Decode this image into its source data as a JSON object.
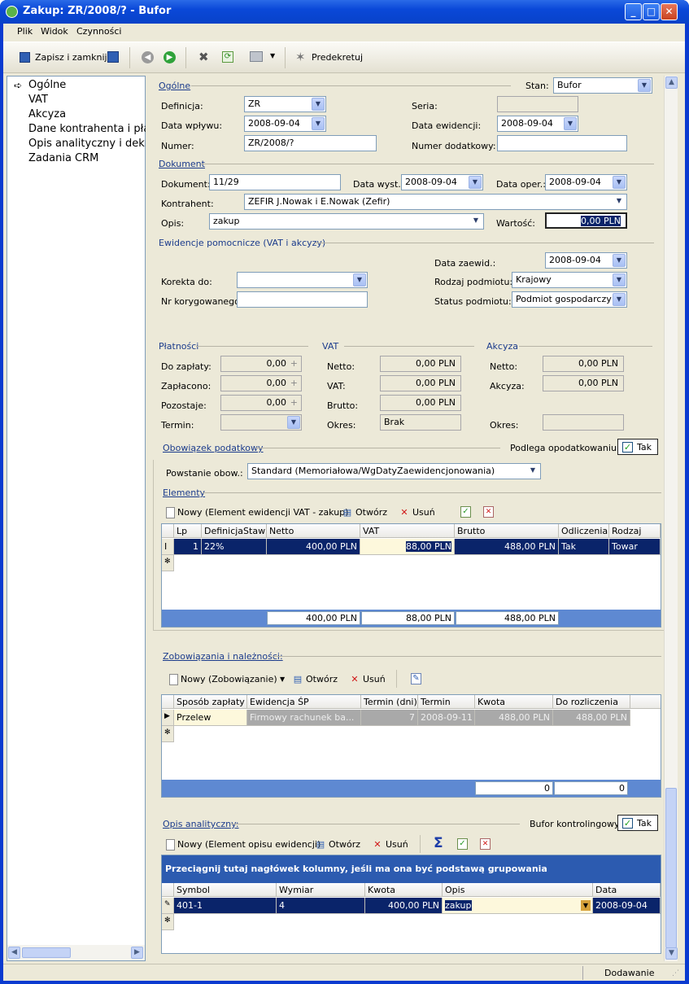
{
  "window": {
    "title": "Zakup: ZR/2008/? - Bufor"
  },
  "menu": [
    "Plik",
    "Widok",
    "Czynności"
  ],
  "toolbar": {
    "save_close": "Zapisz i zamknij",
    "predekretuj": "Predekretuj"
  },
  "nav": {
    "items": [
      "Ogólne",
      "VAT",
      "Akcyza",
      "Dane kontrahenta i płatn",
      "Opis analityczny i dekret",
      "Zadania CRM"
    ]
  },
  "general": {
    "section": "Ogólne",
    "stan_label": "Stan:",
    "stan_value": "Bufor",
    "definicja_label": "Definicja:",
    "definicja_value": "ZR",
    "seria_label": "Seria:",
    "data_wplywu_label": "Data wpływu:",
    "data_wplywu_value": "2008-09-04",
    "data_ewid_label": "Data ewidencji:",
    "data_ewid_value": "2008-09-04",
    "numer_label": "Numer:",
    "numer_value": "ZR/2008/?",
    "numer_dod_label": "Numer dodatkowy:"
  },
  "dokument": {
    "section": "Dokument",
    "dokument_label": "Dokument:",
    "dokument_value": "11/29",
    "data_wyst_label": "Data wyst.:",
    "data_wyst_value": "2008-09-04",
    "data_oper_label": "Data oper.:",
    "data_oper_value": "2008-09-04",
    "kontrahent_label": "Kontrahent:",
    "kontrahent_value": "ZEFIR J.Nowak i E.Nowak (Zefir)",
    "opis_label": "Opis:",
    "opis_value": "zakup",
    "wartosc_label": "Wartość:",
    "wartosc_value": "0,00 PLN"
  },
  "ewidencje": {
    "section": "Ewidencje pomocnicze (VAT i akcyzy)",
    "data_zaewid_label": "Data zaewid.:",
    "data_zaewid_value": "2008-09-04",
    "korekta_label": "Korekta do:",
    "rodzaj_label": "Rodzaj podmiotu:",
    "rodzaj_value": "Krajowy",
    "nr_kor_label": "Nr korygowanego:",
    "status_label": "Status podmiotu:",
    "status_value": "Podmiot gospodarczy"
  },
  "platnosci": {
    "section": "Płatności",
    "do_zaplaty_label": "Do zapłaty:",
    "do_zaplaty_value": "0,00",
    "zaplacono_label": "Zapłacono:",
    "zaplacono_value": "0,00",
    "pozostaje_label": "Pozostaje:",
    "pozostaje_value": "0,00",
    "termin_label": "Termin:"
  },
  "vat": {
    "section": "VAT",
    "netto_label": "Netto:",
    "netto_value": "0,00 PLN",
    "vat_label": "VAT:",
    "vat_value": "0,00 PLN",
    "brutto_label": "Brutto:",
    "brutto_value": "0,00 PLN",
    "okres_label": "Okres:",
    "okres_value": "Brak"
  },
  "akcyza": {
    "section": "Akcyza",
    "netto_label": "Netto:",
    "netto_value": "0,00 PLN",
    "akcyza_label": "Akcyza:",
    "akcyza_value": "0,00 PLN",
    "okres_label": "Okres:"
  },
  "obowiazek": {
    "section": "Obowiązek podatkowy",
    "podlega_label": "Podlega opodatkowaniu:",
    "tak": "Tak",
    "powstanie_label": "Powstanie obow.:",
    "powstanie_value": "Standard (Memoriałowa/WgDatyZaewidencjonowania)"
  },
  "elementy": {
    "section": "Elementy",
    "new": "Nowy (Element ewidencji VAT - zakup)",
    "open": "Otwórz",
    "delete": "Usuń",
    "columns": [
      "Lp",
      "DefinicjaStaw",
      "Netto",
      "VAT",
      "Brutto",
      "Odliczenia",
      "Rodzaj"
    ],
    "row": [
      "1",
      "22%",
      "400,00 PLN",
      "88,00 PLN",
      "488,00 PLN",
      "Tak",
      "Towar"
    ],
    "totals": [
      "400,00 PLN",
      "88,00 PLN",
      "488,00 PLN"
    ]
  },
  "zobowiazania": {
    "section": "Zobowiązania i należności:",
    "new": "Nowy (Zobowiązanie)",
    "open": "Otwórz",
    "delete": "Usuń",
    "columns": [
      "Sposób zapłaty",
      "Ewidencja ŚP",
      "Termin (dni)",
      "Termin",
      "Kwota",
      "Do rozliczenia"
    ],
    "row": [
      "Przelew",
      "Firmowy rachunek ba...",
      "7",
      "2008-09-11",
      "488,00 PLN",
      "488,00 PLN"
    ],
    "totals": [
      "0",
      "0"
    ]
  },
  "opis": {
    "section": "Opis analityczny:",
    "bufor_label": "Bufor kontrolingowy:",
    "tak": "Tak",
    "new": "Nowy (Element opisu ewidencji)",
    "open": "Otwórz",
    "delete": "Usuń",
    "group_hint": "Przeciągnij tutaj nagłówek kolumny, jeśli ma ona być podstawą grupowania",
    "columns": [
      "Symbol",
      "Wymiar",
      "Kwota",
      "Opis",
      "Data"
    ],
    "row": [
      "401-1",
      "4",
      "400,00 PLN",
      "zakup",
      "2008-09-04"
    ]
  },
  "status": {
    "text": "Dodawanie"
  }
}
